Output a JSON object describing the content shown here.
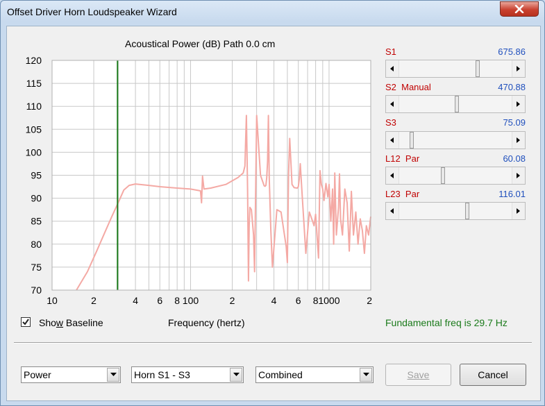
{
  "window": {
    "title": "Offset Driver Horn Loudspeaker Wizard"
  },
  "chart": {
    "title": "Acoustical Power (dB)   Path 0.0 cm",
    "xlabel": "Frequency (hertz)",
    "y_ticks": [
      "120",
      "115",
      "110",
      "105",
      "100",
      "95",
      "90",
      "85",
      "80",
      "75",
      "70"
    ],
    "x_ticks": [
      "10",
      "2",
      "4",
      "6",
      "8",
      "100",
      "2",
      "4",
      "6",
      "8",
      "1000",
      "2"
    ],
    "colors": {
      "curve": "#f4a9a4",
      "marker": "#1a7a1a",
      "grid": "#c8c8c8"
    }
  },
  "chart_data": {
    "type": "line",
    "title": "Acoustical Power (dB)   Path 0.0 cm",
    "xlabel": "Frequency (hertz)",
    "ylabel": "",
    "xscale": "log",
    "xlim": [
      10,
      2000
    ],
    "ylim": [
      70,
      120
    ],
    "grid": true,
    "marker_line_x": 29.7,
    "series": [
      {
        "x": [
          15,
          18,
          21,
          24,
          27,
          30,
          33,
          36,
          40,
          50,
          60,
          80,
          100,
          118,
          120,
          122,
          125,
          140,
          180,
          220,
          240,
          247,
          250,
          253,
          258,
          262,
          265,
          268,
          275,
          285,
          290,
          300,
          320,
          340,
          345,
          350,
          355,
          360,
          365,
          370,
          380,
          390,
          420,
          450,
          490,
          500,
          510,
          520,
          540,
          560,
          590,
          600,
          610,
          620,
          640,
          680,
          720,
          740,
          760,
          780,
          800,
          840,
          860,
          880,
          900,
          920,
          950,
          980,
          1000,
          1030,
          1060,
          1080,
          1100,
          1130,
          1170,
          1190,
          1210,
          1250,
          1300,
          1350,
          1400,
          1450,
          1500,
          1560,
          1620,
          1680,
          1740,
          1800,
          1860,
          1930,
          2000
        ],
        "y": [
          70,
          74,
          78.5,
          82.5,
          86,
          89,
          91.8,
          92.8,
          93.1,
          92.8,
          92.5,
          92.2,
          92,
          91.6,
          89,
          94.8,
          92,
          92.2,
          93,
          94.5,
          95.5,
          97,
          103,
          108,
          92,
          72,
          84,
          88,
          87.5,
          82,
          74,
          108,
          95,
          92.7,
          92.6,
          92.8,
          94.5,
          98,
          108,
          94.5,
          83,
          75,
          87.5,
          87,
          79.5,
          76,
          95,
          103,
          93,
          92.3,
          92.2,
          92.5,
          94.2,
          97.5,
          90.5,
          78,
          87,
          86,
          85,
          84,
          86.5,
          77,
          96,
          93,
          92,
          89.5,
          93.2,
          90.3,
          93,
          85,
          92,
          80,
          95.5,
          82,
          88,
          95.3,
          85.5,
          82,
          92,
          89,
          78.5,
          91.5,
          82,
          87,
          80,
          85.5,
          83,
          78,
          84,
          82,
          86
        ]
      }
    ]
  },
  "sliders": [
    {
      "name": "S1",
      "value": "675.86",
      "position": 0.77
    },
    {
      "name": "S2  Manual",
      "value": "470.88",
      "position": 0.57
    },
    {
      "name": "S3",
      "value": "75.09",
      "position": 0.08
    },
    {
      "name": "L12  Par",
      "value": "60.08",
      "position": 0.45
    },
    {
      "name": "L23  Par",
      "value": "116.01",
      "position": 0.68
    }
  ],
  "baseline": {
    "label_pre": "Sho",
    "label_ul": "w",
    "label_post": " Baseline",
    "checked": true
  },
  "status": {
    "text": "Fundamental freq is 29.7 Hz",
    "color": "#1a7a1a"
  },
  "dropdowns": {
    "mode": "Power",
    "horn": "Horn S1 - S3",
    "combo": "Combined"
  },
  "buttons": {
    "save": "Save",
    "cancel": "Cancel"
  }
}
